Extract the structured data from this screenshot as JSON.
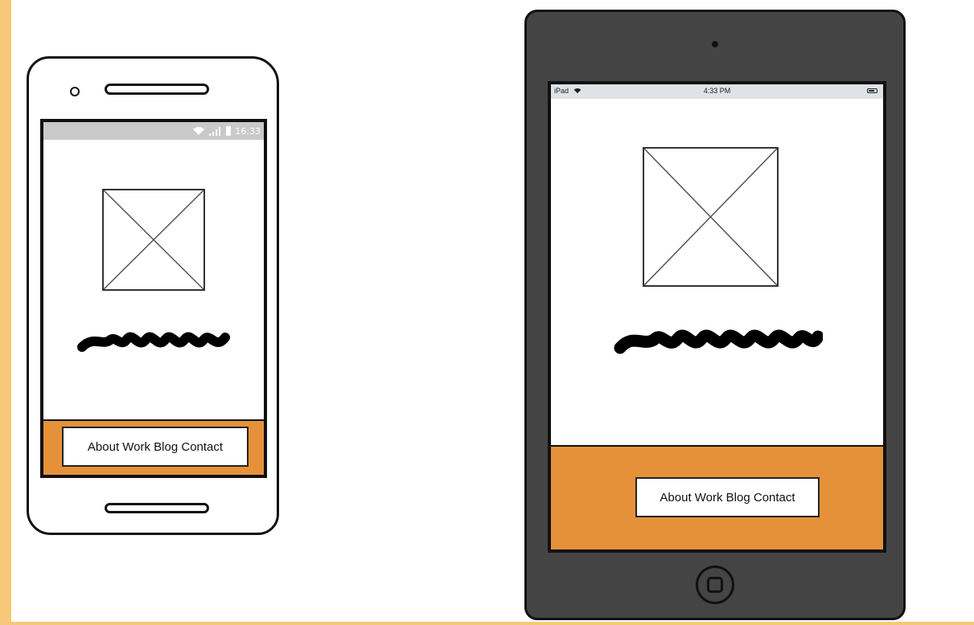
{
  "android_mockup": {
    "status_time": "16:33",
    "nav_label": "About Work Blog Contact"
  },
  "ipad_mockup": {
    "status_device": "iPad",
    "status_time": "4:33 PM",
    "nav_label": "About Work Blog Contact"
  },
  "colors": {
    "accent_orange": "#e5913a",
    "frame_dark": "#444444",
    "side_strip": "#f7c878"
  },
  "icons": [
    "wifi-icon",
    "signal-icon",
    "battery-icon",
    "image-placeholder-icon",
    "home-button-icon"
  ]
}
